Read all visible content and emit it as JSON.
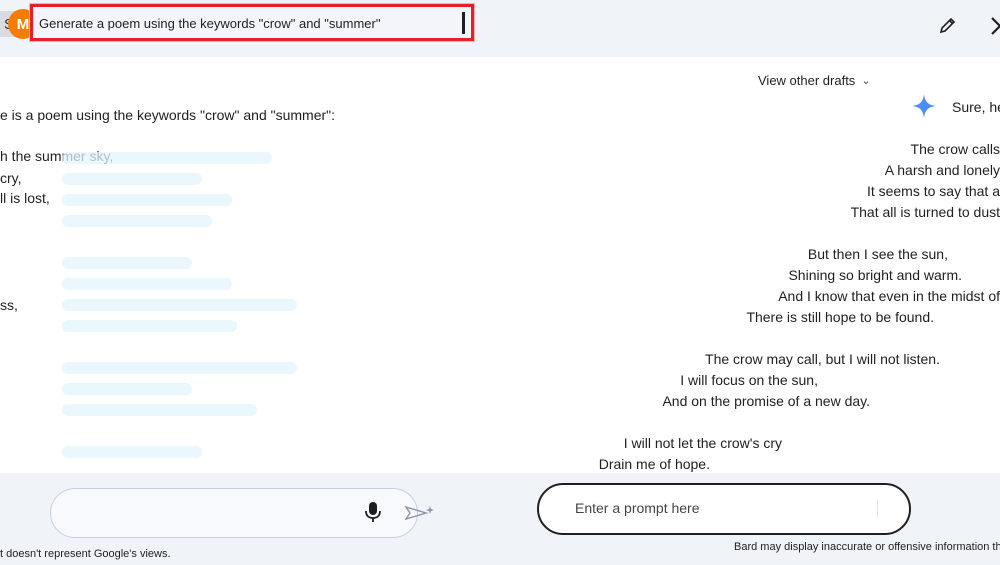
{
  "header": {
    "avatar_letter": "M",
    "avatar_side_letter": "S",
    "prompt": "Generate a poem using the keywords \"crow\" and \"summer\""
  },
  "response": {
    "view_drafts": "View other drafts",
    "intro_partial": "Sure, he",
    "left_intro": "e is a poem using the keywords \"crow\" and \"summer\":",
    "left_lines": [
      "h the summer sky,",
      "cry,",
      "ll is lost,",
      "ss,"
    ],
    "poem_lines": [
      "The crow calls",
      "A harsh and lonely",
      "It seems to say that a",
      "That all is turned to dust",
      "But then I see the sun,",
      "Shining so bright and warm.",
      "And I know that even in the midst of",
      "There is still hope to be found.",
      "The crow may call, but I will not listen.",
      "I will focus on the sun,",
      "And on the promise of a new day.",
      "I will not let the crow's cry",
      "Drain me of hope."
    ]
  },
  "input": {
    "placeholder": "Enter a prompt here"
  },
  "footer": {
    "disclaimer_left": "t doesn't represent Google's views.",
    "disclaimer_right": "Bard may display inaccurate or offensive information th"
  },
  "colors": {
    "highlight_border": "#e5202b",
    "avatar": "#f57c00",
    "background": "#f0f4f9",
    "sparkle": "#4c8df6"
  }
}
